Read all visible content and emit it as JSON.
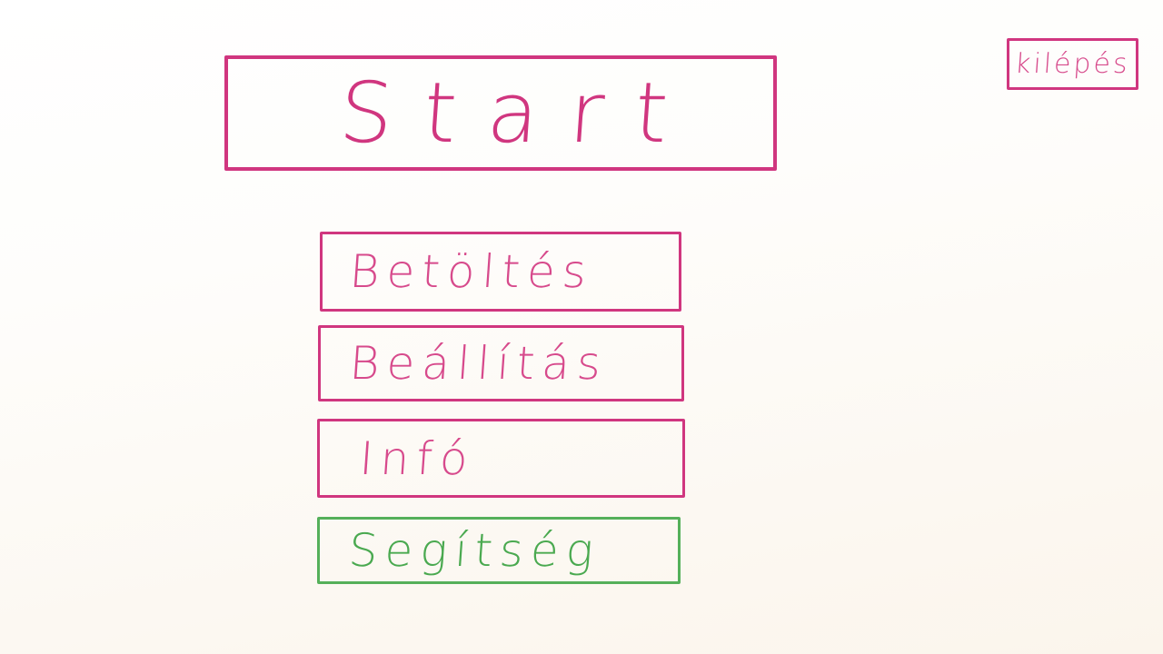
{
  "menu": {
    "start_label": "Start",
    "load_label": "Betöltés",
    "settings_label": "Beállítás",
    "info_label": "Infó",
    "help_label": "Segítség",
    "exit_label": "kilépés"
  },
  "colors": {
    "primary_border": "#d0367f",
    "primary_text": "#d74a8c",
    "help_border": "#55b05a",
    "help_text": "#4aa950"
  }
}
